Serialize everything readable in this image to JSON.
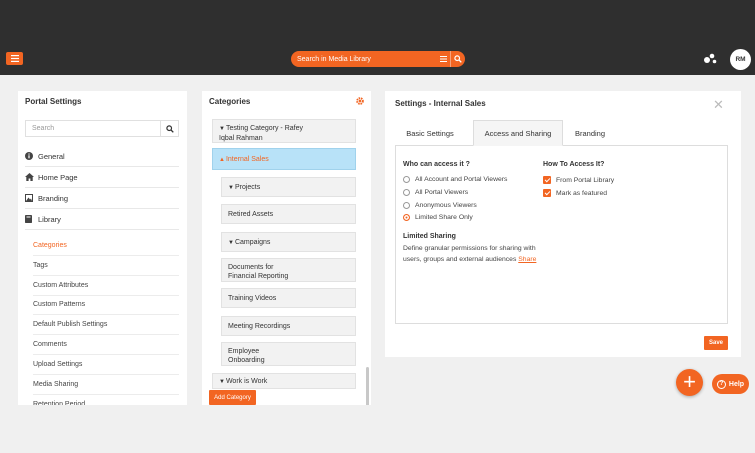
{
  "header": {
    "search_placeholder": "Search in Media Library",
    "avatar_initials": "RM"
  },
  "portal_settings": {
    "title": "Portal Settings",
    "search_placeholder": "Search",
    "nav": [
      "General",
      "Home Page",
      "Branding",
      "Library"
    ],
    "library_items": [
      "Categories",
      "Tags",
      "Custom Attributes",
      "Custom Patterns",
      "Default Publish Settings",
      "Comments",
      "Upload Settings",
      "Media Sharing",
      "Retention Period"
    ],
    "active_item": "Categories"
  },
  "categories": {
    "title": "Categories",
    "items": [
      {
        "line1": "Testing Category - Rafey",
        "line2": "Iqbal Rahman"
      },
      {
        "line1": "Internal Sales"
      },
      {
        "line1": "Projects"
      },
      {
        "line1": "Retired Assets"
      },
      {
        "line1": "Campaigns"
      },
      {
        "line1": "Documents for",
        "line2": "Financial Reporting"
      },
      {
        "line1": "Training Videos"
      },
      {
        "line1": "Meeting Recordings"
      },
      {
        "line1": "Employee",
        "line2": "Onboarding"
      },
      {
        "line1": "Work is Work"
      }
    ],
    "add_button": "Add Category"
  },
  "settings": {
    "title": "Settings - Internal Sales",
    "tabs": [
      "Basic Settings",
      "Access and Sharing",
      "Branding"
    ],
    "active_tab": "Access and Sharing",
    "who_label": "Who can access it ?",
    "who_options": [
      "All Account and Portal Viewers",
      "All Portal Viewers",
      "Anonymous Viewers",
      "Limited Share Only"
    ],
    "who_selected": "Limited Share Only",
    "how_label": "How To Access It?",
    "how_options": [
      "From Portal Library",
      "Mark as featured"
    ],
    "limited_title": "Limited Sharing",
    "limited_text": "Define granular permissions for sharing with users, groups and external audiences",
    "limited_link": "Share",
    "save_button": "Save"
  },
  "help_button": "Help",
  "fab_label": "+",
  "colors": {
    "accent": "#f26522",
    "topbar": "#2f2f2f",
    "selected_row": "#b8e2f8"
  }
}
